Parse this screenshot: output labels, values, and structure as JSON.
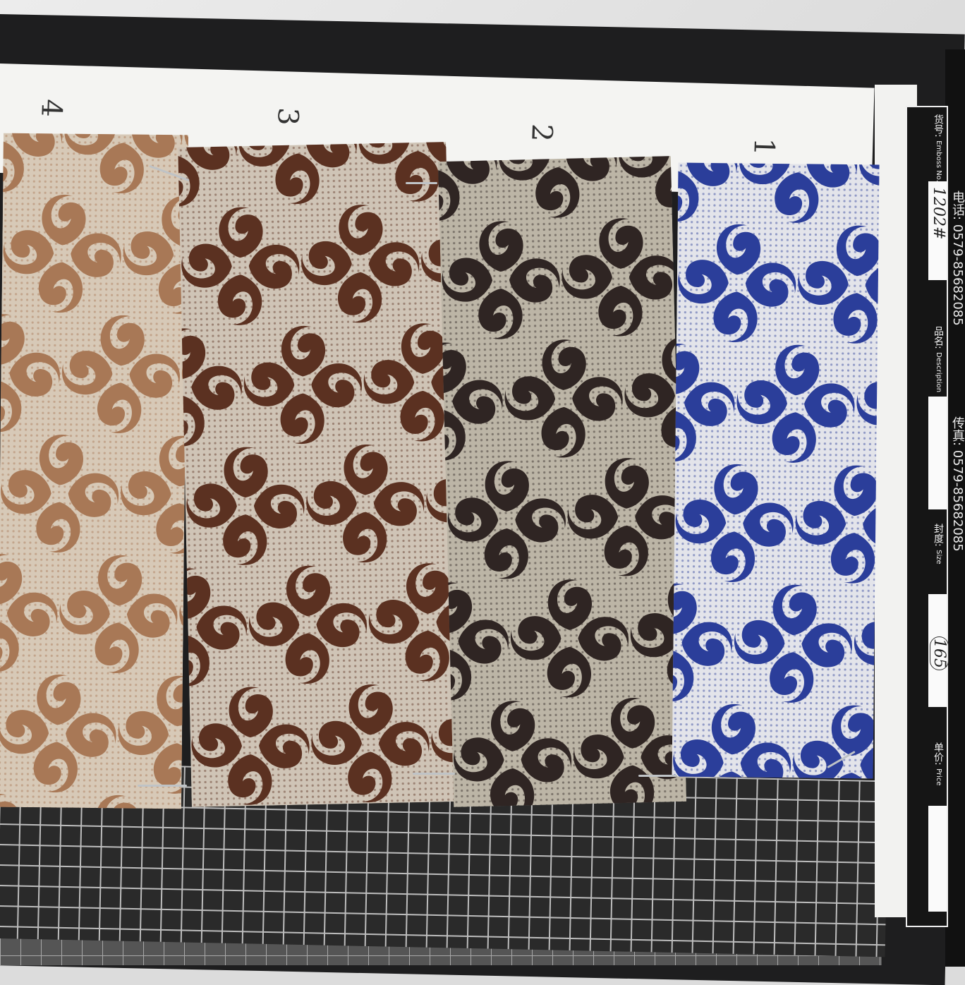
{
  "sample_numbers": [
    "4",
    "3",
    "2",
    "1"
  ],
  "label_card": {
    "contact_phone": "电话: 0579-85682085",
    "contact_fax": "传真: 0579-85682085",
    "rows": [
      {
        "key_cn": "货号:",
        "key_en": "Emboss No.",
        "value": "1202#"
      },
      {
        "key_cn": "品名:",
        "key_en": "Description",
        "value": ""
      },
      {
        "key_cn": "封度:",
        "key_en": "Size",
        "value": "165"
      },
      {
        "key_cn": "单价:",
        "key_en": "Price",
        "value": ""
      }
    ]
  },
  "swatches": [
    {
      "name": "swatch-4",
      "ground": "#d7c9b7",
      "motif": "#a87856"
    },
    {
      "name": "swatch-3",
      "ground": "#cfc4b6",
      "motif": "#5b3121"
    },
    {
      "name": "swatch-2",
      "ground": "#bcb5a6",
      "motif": "#2f2523"
    },
    {
      "name": "swatch-1",
      "ground": "#e3e4ea",
      "motif": "#2b3e9a"
    }
  ]
}
